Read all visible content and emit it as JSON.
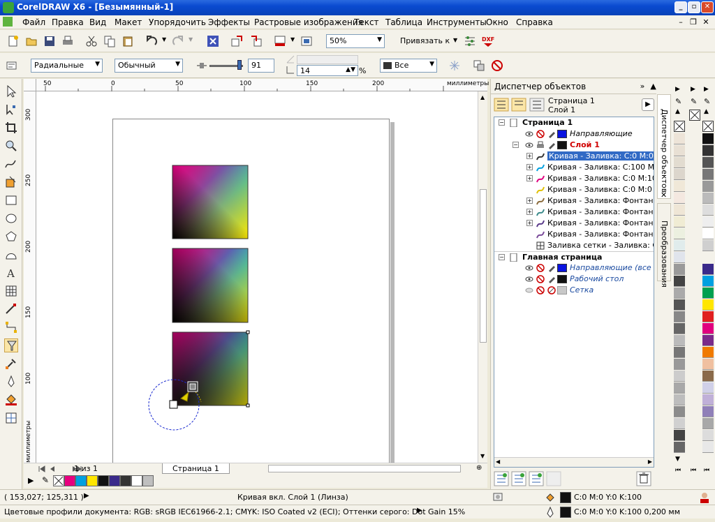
{
  "window": {
    "title": "CorelDRAW X6 - [Безымянный-1]"
  },
  "menu": [
    "Файл",
    "Правка",
    "Вид",
    "Макет",
    "Упорядочить",
    "Эффекты",
    "Растровые изображения",
    "Текст",
    "Таблица",
    "Инструменты",
    "Окно",
    "Справка"
  ],
  "toolbar1": {
    "zoom": "50%",
    "snap_label": "Привязать к"
  },
  "toolbar2": {
    "fill_type": "Радиальные",
    "merge_mode": "Обычный",
    "transparency": "91",
    "angle": "14",
    "percent": "%",
    "apply_to": "Все"
  },
  "rulers": {
    "unit": "миллиметры",
    "top_ticks": [
      "50",
      "0",
      "50",
      "100",
      "150",
      "200"
    ],
    "left_ticks": [
      "300",
      "250",
      "200",
      "150",
      "100"
    ]
  },
  "page_nav": {
    "count": "1 из 1",
    "tab": "Страница 1"
  },
  "obj_manager": {
    "title": "Диспетчер объектов",
    "page_label": "Страница 1",
    "layer_label": "Слой 1",
    "side_tab_1": "Диспетчер объектов",
    "side_tab_2": "Преобразования",
    "tree": [
      {
        "text": "Страница 1",
        "bold": true
      },
      {
        "text": "Направляющие",
        "italic": true
      },
      {
        "text": "Слой 1",
        "bold": true,
        "red": true
      },
      {
        "text": "Кривая - Заливка: C:0 M:0 Y:0",
        "selected": true
      },
      {
        "text": "Кривая - Заливка: C:100 M:0"
      },
      {
        "text": "Кривая - Заливка: C:0 M:100"
      },
      {
        "text": "Кривая - Заливка: C:0 M:0 Y:1"
      },
      {
        "text": "Кривая - Заливка: Фонтанная"
      },
      {
        "text": "Кривая - Заливка: Фонтанная"
      },
      {
        "text": "Кривая - Заливка: Фонтанная"
      },
      {
        "text": "Кривая - Заливка: Фонтанная"
      },
      {
        "text": "Заливка сетки - Заливка: Сетк"
      },
      {
        "text": "Главная страница",
        "bold": true
      },
      {
        "text": "Направляющие (все стр",
        "italic": true,
        "blue": true
      },
      {
        "text": "Рабочий стол",
        "italic": true,
        "blue": true
      },
      {
        "text": "Сетка",
        "italic": true,
        "blue": true
      }
    ]
  },
  "status": {
    "coords": "( 153,027; 125,311 )",
    "object": "Кривая вкл. Слой 1  (Линза)",
    "profiles": "Цветовые профили документа: RGB: sRGB IEC61966-2.1; CMYK: ISO Coated v2 (ECI); Оттенки серого: Dot Gain 15%",
    "fill": "C:0 M:0 Y:0 K:100",
    "outline": "C:0 M:0 Y:0 K:100  0,200 мм"
  },
  "colors": {
    "accent": "#316ac5",
    "bottom_palette": [
      "#e8007f",
      "#00a0e0",
      "#ffe600",
      "#111111",
      "#3a2a8a",
      "#333333",
      "#ffffff",
      "#bfbfbf"
    ]
  }
}
